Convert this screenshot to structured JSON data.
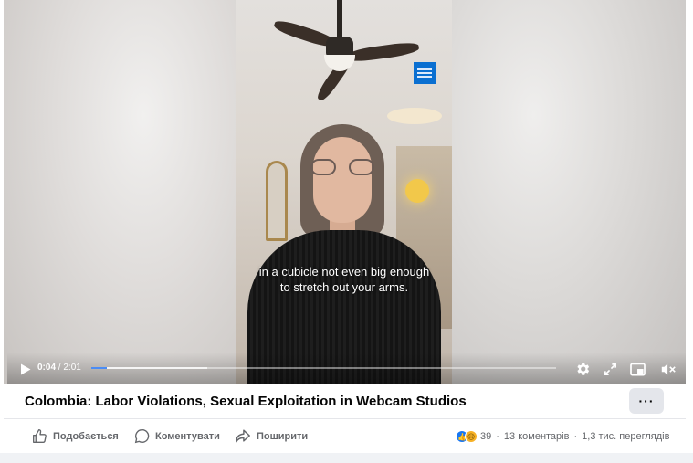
{
  "player": {
    "subtitle_line1": "in a cubicle not even big enough",
    "subtitle_line2": "to stretch out your arms.",
    "time_current": "0:04",
    "time_separator": " / ",
    "time_total": "2:01",
    "progress_fraction": 0.033,
    "buffer_fraction": 0.25,
    "progress_color": "#4b8cf5",
    "icons": [
      "play-icon",
      "settings-icon",
      "fullscreen-icon",
      "picture-in-picture-icon",
      "mute-icon"
    ],
    "channel_logo": "hrw-logo"
  },
  "post": {
    "title": "Colombia: Labor Violations, Sexual Exploitation in Webcam Studios",
    "more_label": "···"
  },
  "actions": {
    "like_label": "Подобається",
    "comment_label": "Коментувати",
    "share_label": "Поширити"
  },
  "stats": {
    "reactions_count": "39",
    "comments": "13 коментарів",
    "views": "1,3 тис. переглядів",
    "separator": "·",
    "reaction_icons": [
      "like-reaction-icon",
      "sad-reaction-icon"
    ],
    "like_color": "#1877f2"
  }
}
